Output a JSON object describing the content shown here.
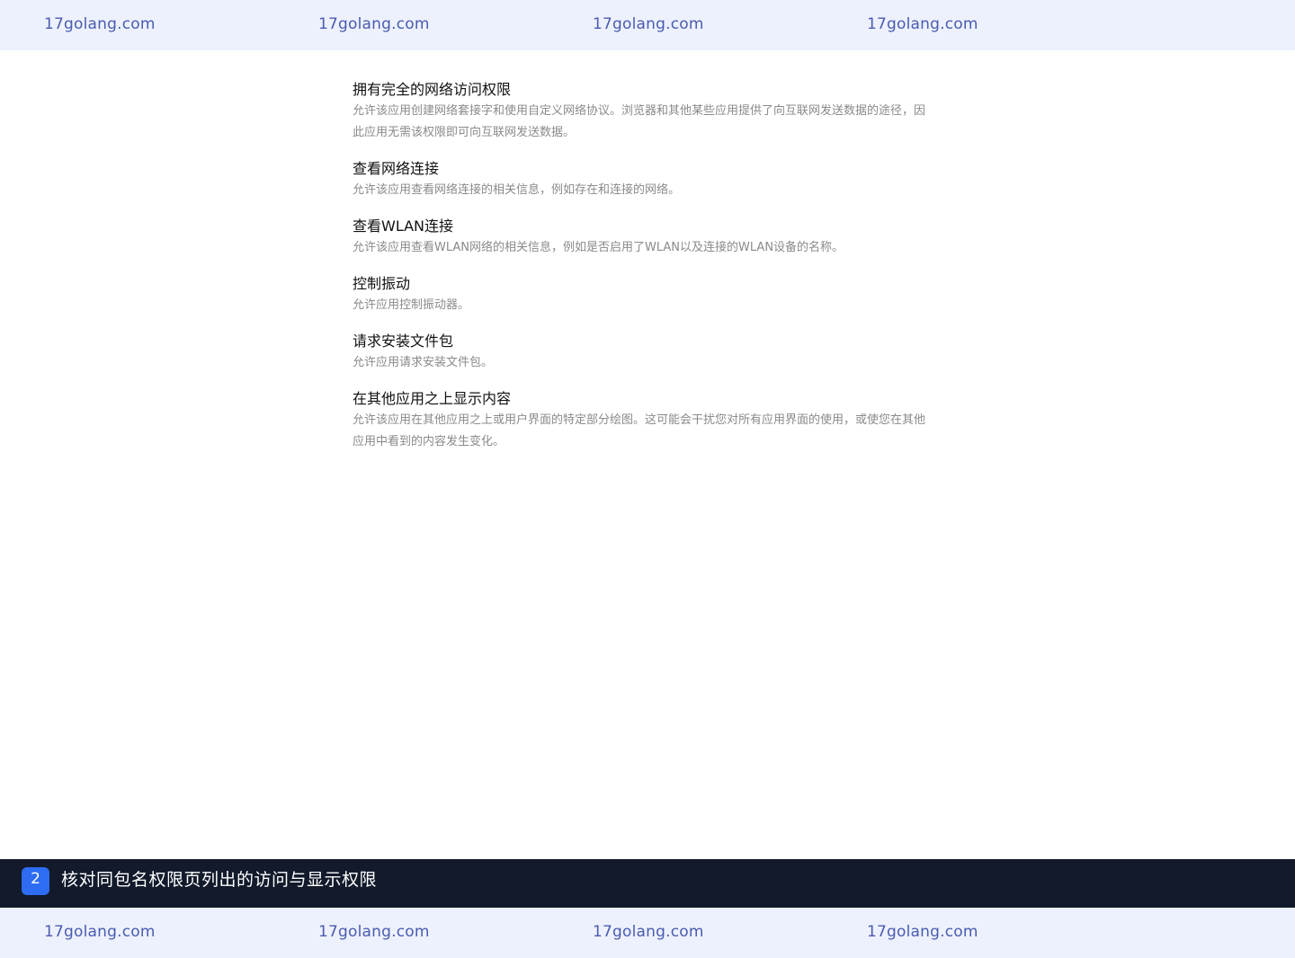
{
  "watermark": {
    "text": "17golang.com"
  },
  "permissions": [
    {
      "title": "拥有完全的网络访问权限",
      "description": "允许该应用创建网络套接字和使用自定义网络协议。浏览器和其他某些应用提供了向互联网发送数据的途径，因此应用无需该权限即可向互联网发送数据。"
    },
    {
      "title": "查看网络连接",
      "description": "允许该应用查看网络连接的相关信息，例如存在和连接的网络。"
    },
    {
      "title": "查看WLAN连接",
      "description": "允许该应用查看WLAN网络的相关信息，例如是否启用了WLAN以及连接的WLAN设备的名称。"
    },
    {
      "title": "控制振动",
      "description": "允许应用控制振动器。"
    },
    {
      "title": "请求安装文件包",
      "description": "允许应用请求安装文件包。"
    },
    {
      "title": "在其他应用之上显示内容",
      "description": "允许该应用在其他应用之上或用户界面的特定部分绘图。这可能会干扰您对所有应用界面的使用，或使您在其他应用中看到的内容发生变化。"
    }
  ],
  "caption": {
    "step_number": "2",
    "text": "核对同包名权限页列出的访问与显示权限"
  },
  "colors": {
    "banner_bg": "#edf1fd",
    "watermark": "#4a5bb0",
    "caption_bg": "#121a2b",
    "badge": "#2e6cf3",
    "title_text": "#111111",
    "desc_text": "#8a8a8a"
  }
}
